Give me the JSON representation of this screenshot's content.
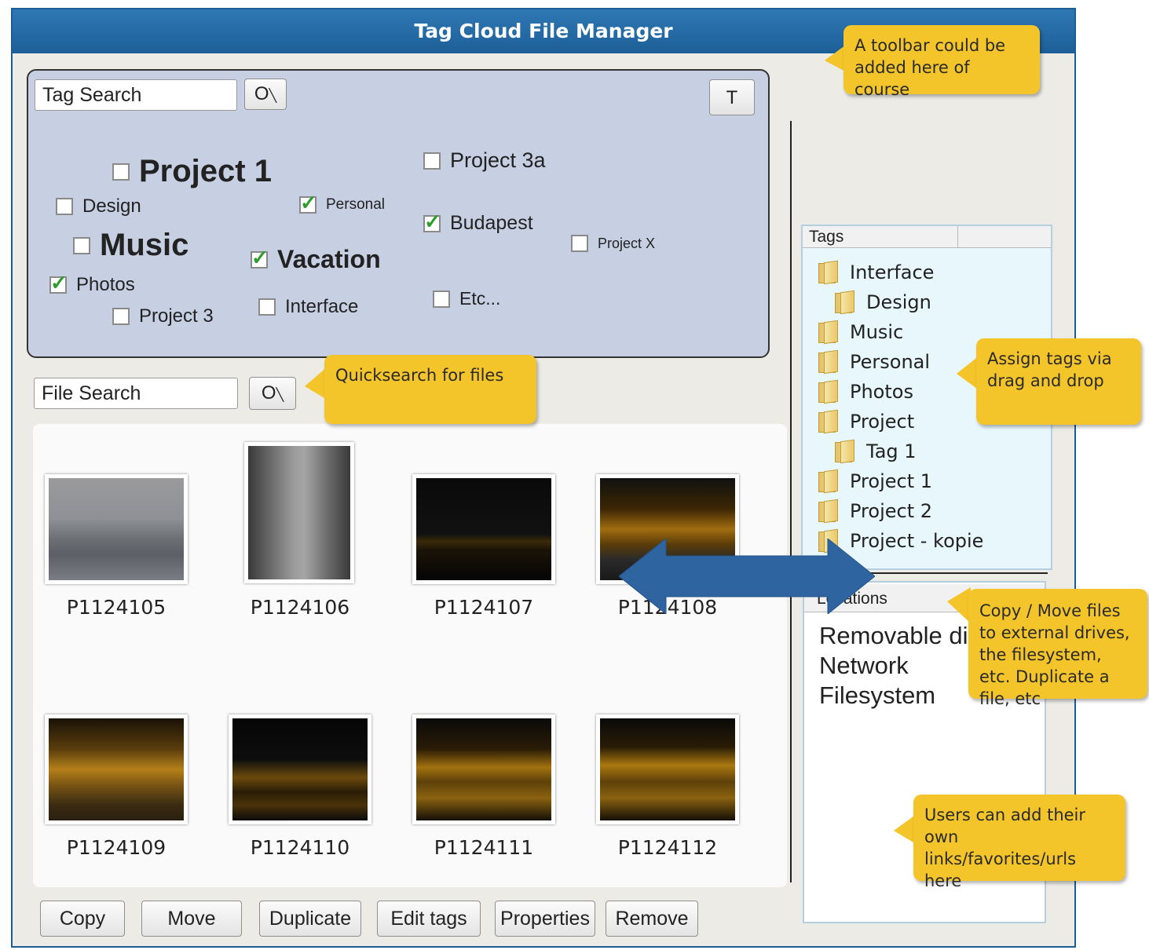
{
  "window": {
    "title": "Tag Cloud File Manager"
  },
  "tag_search": {
    "value": "Tag Search",
    "search_button_label": "O",
    "t_button_label": "T"
  },
  "tag_cloud": [
    {
      "label": "Project 1",
      "checked": false
    },
    {
      "label": "Project 3a",
      "checked": false
    },
    {
      "label": "Design",
      "checked": false
    },
    {
      "label": "Personal",
      "checked": true
    },
    {
      "label": "Budapest",
      "checked": true
    },
    {
      "label": "Music",
      "checked": false
    },
    {
      "label": "Vacation",
      "checked": true
    },
    {
      "label": "Project X",
      "checked": false
    },
    {
      "label": "Photos",
      "checked": true
    },
    {
      "label": "Interface",
      "checked": false
    },
    {
      "label": "Etc...",
      "checked": false
    },
    {
      "label": "Project 3",
      "checked": false
    }
  ],
  "file_search": {
    "value": "File Search",
    "search_button_label": "O"
  },
  "files": [
    {
      "name": "P1124105"
    },
    {
      "name": "P1124106"
    },
    {
      "name": "P1124107"
    },
    {
      "name": "P1124108"
    },
    {
      "name": "P1124109"
    },
    {
      "name": "P1124110"
    },
    {
      "name": "P1124111"
    },
    {
      "name": "P1124112"
    }
  ],
  "actions": [
    "Copy",
    "Move",
    "Duplicate",
    "Edit tags",
    "Properties",
    "Remove"
  ],
  "tags_panel": {
    "header": "Tags",
    "items": [
      "Interface",
      "Design",
      "Music",
      "Personal",
      "Photos",
      "Project",
      "Tag 1",
      "Project 1",
      "Project 2",
      "Project - kopie"
    ]
  },
  "locations_panel": {
    "header": "Locations",
    "items": [
      "Removable di",
      "Network",
      "Filesystem"
    ]
  },
  "callouts": {
    "toolbar": "A toolbar could be added here of course",
    "quicksearch": "Quicksearch for files",
    "assign": "Assign tags via drag and drop",
    "copy": "Copy / Move files to external drives, the filesystem, etc. Duplicate a file, etc",
    "users": "Users can add their own links/favorites/urls here"
  },
  "colors": {
    "title_bar": "#1f639c",
    "tag_panel_bg": "#c7d0e3",
    "callout": "#f4c52a",
    "arrow": "#2e64a0",
    "check": "#2c9c2c"
  }
}
